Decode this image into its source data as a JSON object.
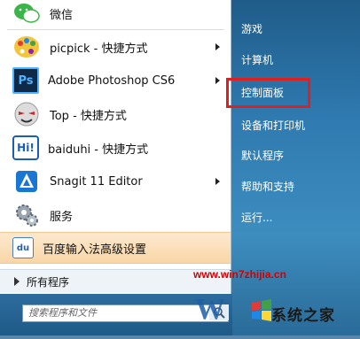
{
  "left_menu": {
    "items": [
      {
        "label": "微信",
        "icon": "wechat-icon",
        "has_arrow": false
      },
      {
        "label": "picpick - 快捷方式",
        "icon": "picpick-icon",
        "has_arrow": true
      },
      {
        "label": "Adobe Photoshop CS6",
        "icon": "photoshop-icon",
        "icon_text": "Ps",
        "has_arrow": true
      },
      {
        "label": "Top - 快捷方式",
        "icon": "top-icon",
        "has_arrow": false
      },
      {
        "label": "baiduhi - 快捷方式",
        "icon": "baiduhi-icon",
        "icon_text": "Hi!",
        "has_arrow": false
      },
      {
        "label": "Snagit 11 Editor",
        "icon": "snagit-icon",
        "has_arrow": true
      },
      {
        "label": "服务",
        "icon": "services-gear-icon",
        "has_arrow": false
      },
      {
        "label": "百度输入法高级设置",
        "icon": "baidu-ime-icon",
        "icon_text": "du",
        "has_arrow": false
      }
    ],
    "all_programs": "所有程序"
  },
  "search": {
    "placeholder": "搜索程序和文件"
  },
  "right_menu": {
    "items": [
      "游戏",
      "计算机",
      "控制面板",
      "设备和打印机",
      "默认程序",
      "帮助和支持",
      "运行..."
    ]
  },
  "watermark": {
    "url": "www.win7zhijia.cn",
    "site_name": "系统之家"
  },
  "colors": {
    "highlight": "#e02020",
    "accent_blue": "#2f7ab0"
  }
}
